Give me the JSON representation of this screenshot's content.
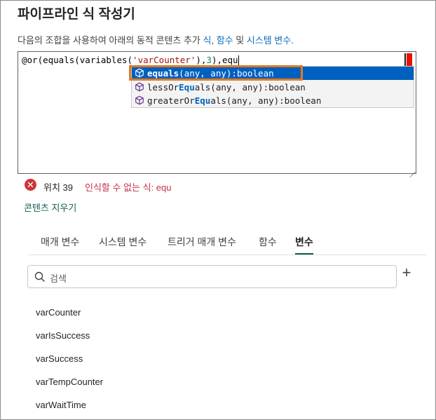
{
  "dialog": {
    "title": "파이프라인 식 작성기",
    "description_prefix": "다음의 조합을 사용하여 아래의 동적 콘텐츠 추가 ",
    "description_link1": "식",
    "description_sep1": ", ",
    "description_link2": "함수",
    "description_sep2": " 및 ",
    "description_link3": "시스템 변수",
    "description_suffix": "."
  },
  "editor": {
    "code_part1": "@or(equals(variables(",
    "code_string": "'varCounter'",
    "code_part2": "),",
    "code_number": "3",
    "code_part3": "),equ"
  },
  "suggestions": [
    {
      "match": "equals",
      "rest": "(any, any):boolean",
      "prefix": "",
      "selected": true,
      "icon": "cube-icon"
    },
    {
      "prefix": "lessOr",
      "match": "Equ",
      "rest": "als(any, any):boolean",
      "selected": false,
      "icon": "cube-icon"
    },
    {
      "prefix": "greaterOr",
      "match": "Equ",
      "rest": "als(any, any):boolean",
      "selected": false,
      "icon": "cube-icon"
    }
  ],
  "error": {
    "position": "위치 39",
    "message": "인식할 수 없는 식: equ"
  },
  "clear_content": "콘텐츠 지우기",
  "tabs": [
    {
      "label": "매개 변수",
      "active": false
    },
    {
      "label": "시스템 변수",
      "active": false
    },
    {
      "label": "트리거 매개 변수",
      "active": false
    },
    {
      "label": "함수",
      "active": false
    },
    {
      "label": "변수",
      "active": true
    }
  ],
  "search": {
    "placeholder": "검색"
  },
  "add_label": "+",
  "variables": [
    "varCounter",
    "varIsSuccess",
    "varSuccess",
    "varTempCounter",
    "varWaitTime"
  ],
  "colors": {
    "accent": "#115c55",
    "link": "#0f6cbd",
    "error": "#d13438",
    "selection": "#0060c0",
    "highlight_box": "#e07b24"
  }
}
